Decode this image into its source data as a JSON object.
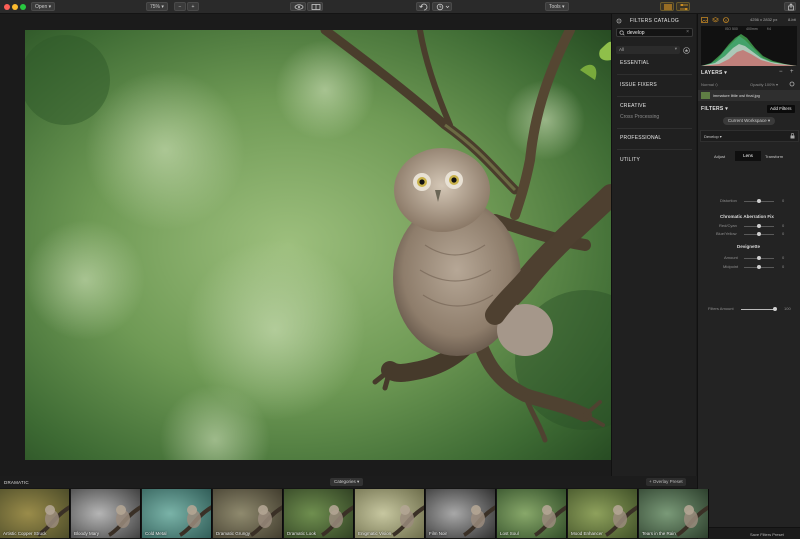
{
  "toolbar": {
    "open_label": "Open ▾",
    "zoom_label": "75% ▾",
    "zoom_out": "−",
    "zoom_in": "+",
    "tools_label": "Tools ▾"
  },
  "catalog": {
    "title": "FILTERS CATALOG",
    "search_value": "develop",
    "filter_all": "All",
    "categories": [
      {
        "label": "ESSENTIAL"
      },
      {
        "label": "ISSUE FIXERS"
      },
      {
        "label": "CREATIVE",
        "sub": "Cross Processing"
      },
      {
        "label": "PROFESSIONAL"
      },
      {
        "label": "UTILITY"
      }
    ]
  },
  "panel": {
    "image_info": "4256 x 2832 px",
    "bit_depth": "8-bit",
    "histogram_labels": [
      "ISO 500",
      "400mm",
      "f/4"
    ],
    "layers_title": "LAYERS ▾",
    "blend_mode": "Normal ◇",
    "opacity": "Opacity 100% ▾",
    "layer_name": "immature little owl final.jpg",
    "filters_title": "FILTERS ▾",
    "add_filters": "Add Filters",
    "workspace": "Current Workspace ▾",
    "filter_name": "Develop ▾",
    "tabs": [
      "Adjust",
      "Lens",
      "Transform"
    ],
    "sliders": [
      {
        "label": "Distortion",
        "value": "0",
        "level": 0.5
      },
      {
        "label": "Red/Cyan",
        "value": "0",
        "level": 0.5
      },
      {
        "label": "Blue/Yellow",
        "value": "0",
        "level": 0.5
      },
      {
        "label": "Amount",
        "value": "0",
        "level": 0.5
      },
      {
        "label": "Midpoint",
        "value": "0",
        "level": 0.5
      }
    ],
    "chromatic_title": "Chromatic Aberration Fix",
    "devignette_title": "Devignette",
    "filters_amount_label": "Filters Amount",
    "filters_amount_value": "100",
    "filters_amount_level": 1.0,
    "save_preset": "Save Filters Preset"
  },
  "presets": {
    "category": "DRAMATIC",
    "categories_button": "Categories ▾",
    "overlay_button": "+ Overlay Preset",
    "items": [
      {
        "label": "Artistic Copper Struck"
      },
      {
        "label": "Bloody Mary"
      },
      {
        "label": "Cold Metal"
      },
      {
        "label": "Dramatic Grungy"
      },
      {
        "label": "Dramatic Look"
      },
      {
        "label": "Enigmatic Vision"
      },
      {
        "label": "Film Noir"
      },
      {
        "label": "Lost Soul"
      },
      {
        "label": "Mood Enhancer"
      },
      {
        "label": "Tears in the Rain"
      }
    ]
  },
  "colors": {
    "accent": "#f5a623",
    "slider_knob": "#cfcfcf"
  }
}
